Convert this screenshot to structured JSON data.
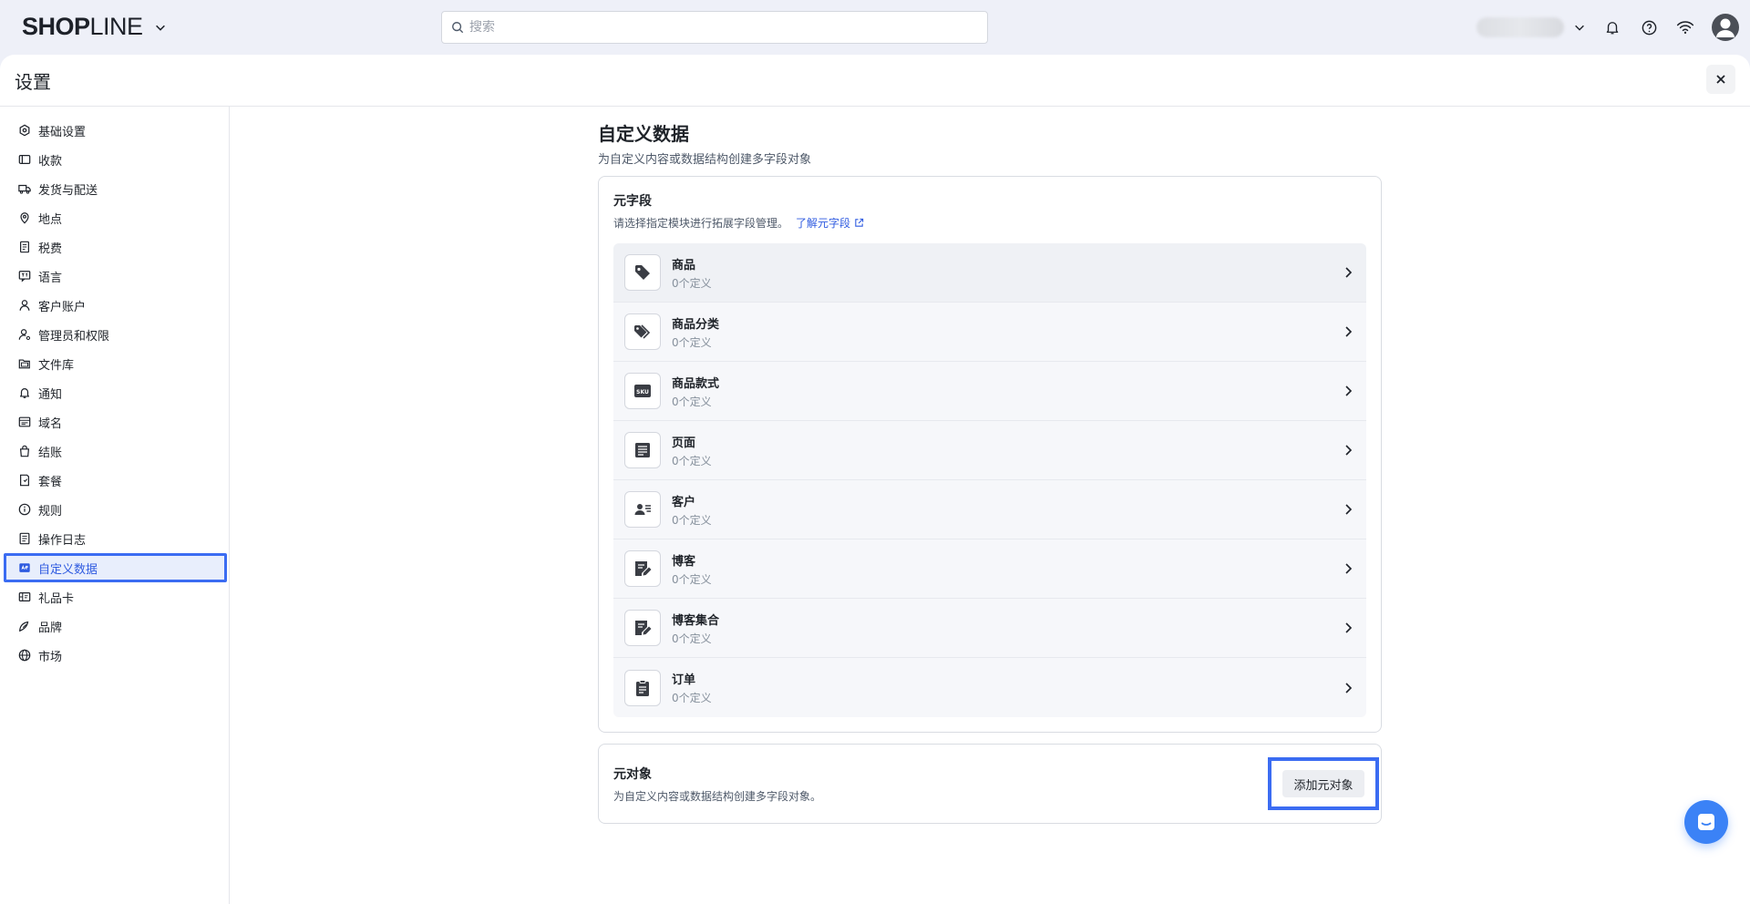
{
  "brand": {
    "logo_bold": "SHOP",
    "logo_light": "LINE"
  },
  "search": {
    "placeholder": "搜索"
  },
  "header": {
    "title": "设置"
  },
  "sidebar": {
    "items": [
      {
        "label": "基础设置",
        "icon": "store-settings-icon"
      },
      {
        "label": "收款",
        "icon": "wallet-icon"
      },
      {
        "label": "发货与配送",
        "icon": "truck-icon"
      },
      {
        "label": "地点",
        "icon": "location-pin-icon"
      },
      {
        "label": "税费",
        "icon": "receipt-icon"
      },
      {
        "label": "语言",
        "icon": "language-icon"
      },
      {
        "label": "客户账户",
        "icon": "user-icon"
      },
      {
        "label": "管理员和权限",
        "icon": "user-gear-icon"
      },
      {
        "label": "文件库",
        "icon": "folder-icon"
      },
      {
        "label": "通知",
        "icon": "bell-icon"
      },
      {
        "label": "域名",
        "icon": "domain-icon"
      },
      {
        "label": "结账",
        "icon": "shopping-bag-icon"
      },
      {
        "label": "套餐",
        "icon": "plan-icon"
      },
      {
        "label": "规则",
        "icon": "info-circle-icon"
      },
      {
        "label": "操作日志",
        "icon": "log-icon"
      },
      {
        "label": "自定义数据",
        "icon": "custom-data-icon",
        "active": true
      },
      {
        "label": "礼品卡",
        "icon": "gift-card-icon"
      },
      {
        "label": "品牌",
        "icon": "brand-icon"
      },
      {
        "label": "市场",
        "icon": "globe-icon"
      }
    ]
  },
  "main": {
    "title": "自定义数据",
    "subtitle": "为自定义内容或数据结构创建多字段对象",
    "metafields": {
      "title": "元字段",
      "description": "请选择指定模块进行拓展字段管理。",
      "learn_link": "了解元字段",
      "rows": [
        {
          "name": "商品",
          "count": "0个定义",
          "icon": "tag-icon"
        },
        {
          "name": "商品分类",
          "count": "0个定义",
          "icon": "tags-icon"
        },
        {
          "name": "商品款式",
          "count": "0个定义",
          "icon": "sku-icon",
          "icon_text": "SKU"
        },
        {
          "name": "页面",
          "count": "0个定义",
          "icon": "page-icon"
        },
        {
          "name": "客户",
          "count": "0个定义",
          "icon": "customer-card-icon"
        },
        {
          "name": "博客",
          "count": "0个定义",
          "icon": "blog-edit-icon"
        },
        {
          "name": "博客集合",
          "count": "0个定义",
          "icon": "blog-collection-icon"
        },
        {
          "name": "订单",
          "count": "0个定义",
          "icon": "clipboard-icon"
        }
      ]
    },
    "metaobjects": {
      "title": "元对象",
      "description": "为自定义内容或数据结构创建多字段对象。",
      "add_button": "添加元对象"
    }
  },
  "colors": {
    "accent": "#2f5be0",
    "highlight": "#3b6cf2",
    "fab": "#3b82f6"
  }
}
